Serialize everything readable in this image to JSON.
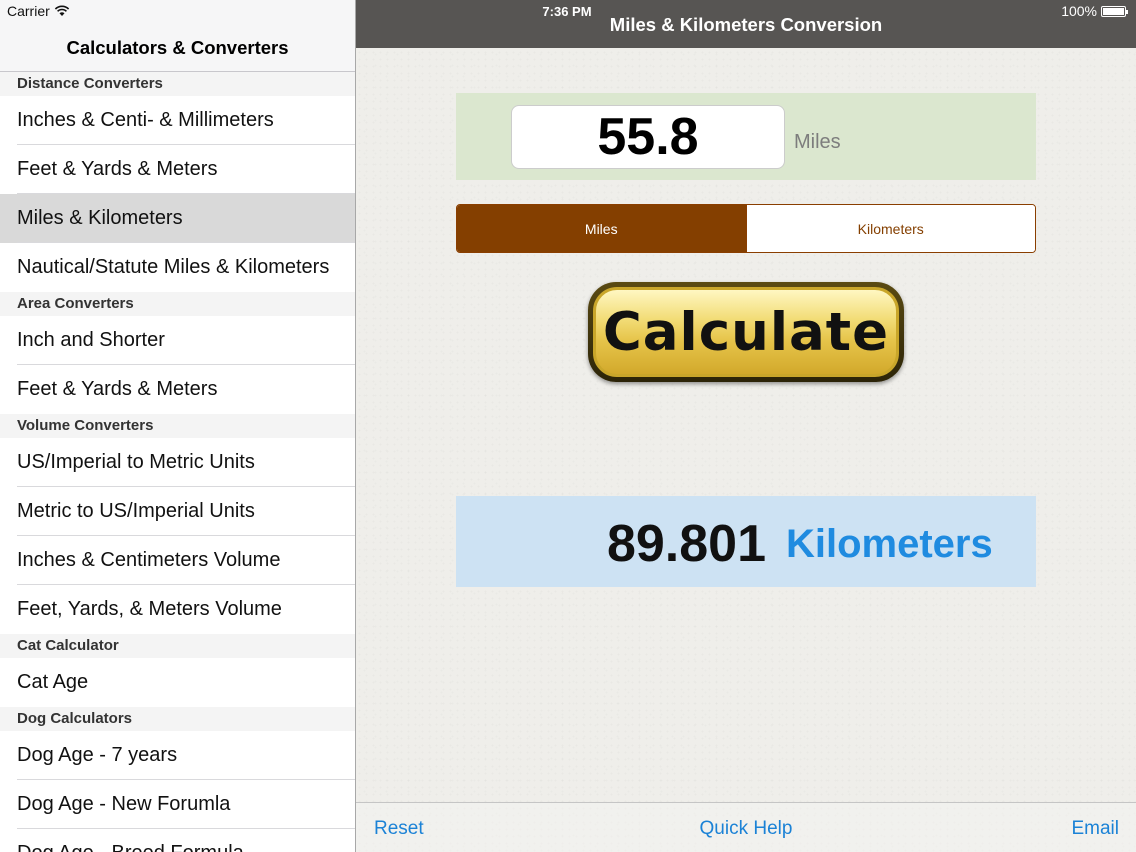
{
  "status_bar": {
    "carrier": "Carrier",
    "time": "7:36 PM",
    "battery": "100%"
  },
  "master": {
    "title": "Calculators & Converters",
    "sections": [
      {
        "header": "Distance Converters",
        "items": [
          "Inches & Centi- & Millimeters",
          "Feet & Yards & Meters",
          "Miles & Kilometers",
          "Nautical/Statute Miles & Kilometers"
        ]
      },
      {
        "header": "Area Converters",
        "items": [
          "Inch and Shorter",
          "Feet & Yards & Meters"
        ]
      },
      {
        "header": "Volume Converters",
        "items": [
          "US/Imperial to Metric Units",
          "Metric to US/Imperial Units",
          "Inches & Centimeters Volume",
          "Feet, Yards, & Meters Volume"
        ]
      },
      {
        "header": "Cat Calculator",
        "items": [
          "Cat Age"
        ]
      },
      {
        "header": "Dog Calculators",
        "items": [
          "Dog Age - 7 years",
          "Dog Age - New Forumla",
          "Dog Age - Breed Formula"
        ]
      }
    ],
    "selected": "Miles & Kilometers"
  },
  "detail": {
    "title": "Miles & Kilometers Conversion",
    "input": {
      "value": "55.8",
      "unit": "Miles"
    },
    "segments": [
      "Miles",
      "Kilometers"
    ],
    "selected_segment": "Miles",
    "calculate_label": "Calculate",
    "result": {
      "value": "89.801",
      "unit": "Kilometers"
    },
    "toolbar": {
      "reset": "Reset",
      "help": "Quick Help",
      "email": "Email"
    }
  },
  "colors": {
    "accent_brown": "#843f00",
    "result_blue": "#1f8be0",
    "link_blue": "#1b82d6",
    "nav_gray": "#575553"
  }
}
